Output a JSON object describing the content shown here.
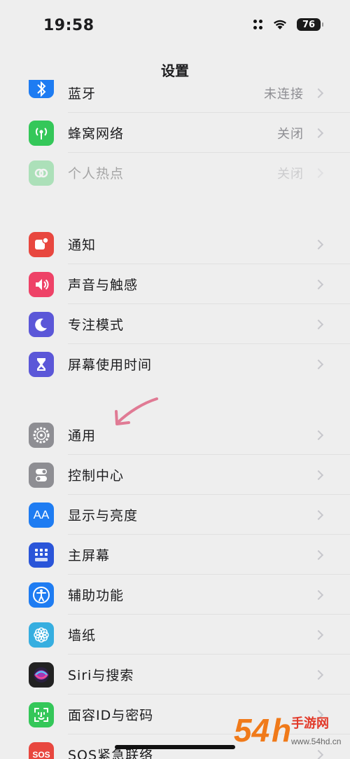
{
  "status": {
    "time": "19:58",
    "battery": "76"
  },
  "nav": {
    "title": "设置"
  },
  "groups": [
    {
      "items": [
        {
          "label": "蓝牙",
          "value": "未连接",
          "icon": "bluetooth-icon",
          "color": "#1e7cf2"
        },
        {
          "label": "蜂窝网络",
          "value": "关闭",
          "icon": "cellular-icon",
          "color": "#34c759"
        },
        {
          "label": "个人热点",
          "value": "关闭",
          "icon": "hotspot-icon",
          "color": "#34c759"
        }
      ]
    },
    {
      "items": [
        {
          "label": "通知",
          "icon": "notifications-icon",
          "color": "#e8473f"
        },
        {
          "label": "声音与触感",
          "icon": "sound-icon",
          "color": "#ee4267"
        },
        {
          "label": "专注模式",
          "icon": "focus-moon-icon",
          "color": "#5b57d8"
        },
        {
          "label": "屏幕使用时间",
          "icon": "hourglass-icon",
          "color": "#5b57d8"
        }
      ]
    },
    {
      "items": [
        {
          "label": "通用",
          "icon": "gear-icon",
          "color": "#8e8e93"
        },
        {
          "label": "控制中心",
          "icon": "toggles-icon",
          "color": "#8e8e93"
        },
        {
          "label": "显示与亮度",
          "icon": "display-aa-icon",
          "color": "#1e7cf2"
        },
        {
          "label": "主屏幕",
          "icon": "home-screen-icon",
          "color": "#2a55d9"
        },
        {
          "label": "辅助功能",
          "icon": "accessibility-icon",
          "color": "#1e7cf2"
        },
        {
          "label": "墙纸",
          "icon": "wallpaper-flower-icon",
          "color": "#36aee0"
        },
        {
          "label": "Siri与搜索",
          "icon": "siri-icon",
          "color": "#222222"
        },
        {
          "label": "面容ID与密码",
          "icon": "face-id-icon",
          "color": "#34c759"
        },
        {
          "label": "SOS紧急联络",
          "icon": "sos-icon",
          "color": "#e8473f"
        }
      ]
    }
  ],
  "watermark": {
    "text": "54hd手游网",
    "sub": "www.54hd.cn"
  }
}
